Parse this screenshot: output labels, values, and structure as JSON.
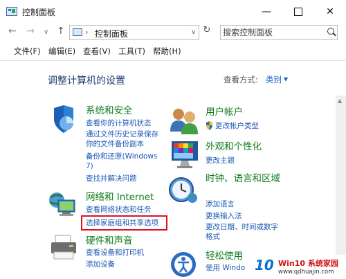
{
  "window": {
    "title": "控制面板",
    "minimize_glyph": "—",
    "close_glyph": "✕"
  },
  "toolbar": {
    "back_glyph": "←",
    "forward_glyph": "→",
    "dropdown_glyph": "∨",
    "up_glyph": "↑",
    "address_sep": "›",
    "address_text": "控制面板",
    "address_drop": "∨",
    "refresh_glyph": "↻",
    "search_placeholder": "搜索控制面板"
  },
  "menu": {
    "file": "文件(F)",
    "edit": "编辑(E)",
    "view": "查看(V)",
    "tools": "工具(T)",
    "help": "帮助(H)"
  },
  "main": {
    "heading": "调整计算机的设置",
    "view_by_label": "查看方式:",
    "view_by_value": "类别",
    "view_by_drop": "▼"
  },
  "categories": {
    "system": {
      "title": "系统和安全",
      "links": [
        "查看你的计算机状态",
        "通过文件历史记录保存你的文件备份副本",
        "备份和还原(Windows 7)",
        "查找并解决问题"
      ]
    },
    "network": {
      "title": "网络和 Internet",
      "links": [
        "查看网络状态和任务",
        "选择家庭组和共享选项"
      ]
    },
    "hardware": {
      "title": "硬件和声音",
      "links": [
        "查看设备和打印机",
        "添加设备"
      ]
    },
    "users": {
      "title": "用户帐户",
      "links": [
        "更改帐户类型"
      ]
    },
    "appearance": {
      "title": "外观和个性化",
      "links": [
        "更改主题"
      ]
    },
    "clock": {
      "title": "时钟、语言和区域",
      "links": [
        "添加语言",
        "更换输入法",
        "更改日期、时间或数字格式"
      ]
    },
    "ease": {
      "title": "轻松使用",
      "links": [
        "使用 Windo"
      ]
    }
  },
  "scroll_up_glyph": "▲",
  "watermark": {
    "logo": "10",
    "site_name": "Win10 系统家园",
    "url": "www.qdhuajin.com"
  }
}
